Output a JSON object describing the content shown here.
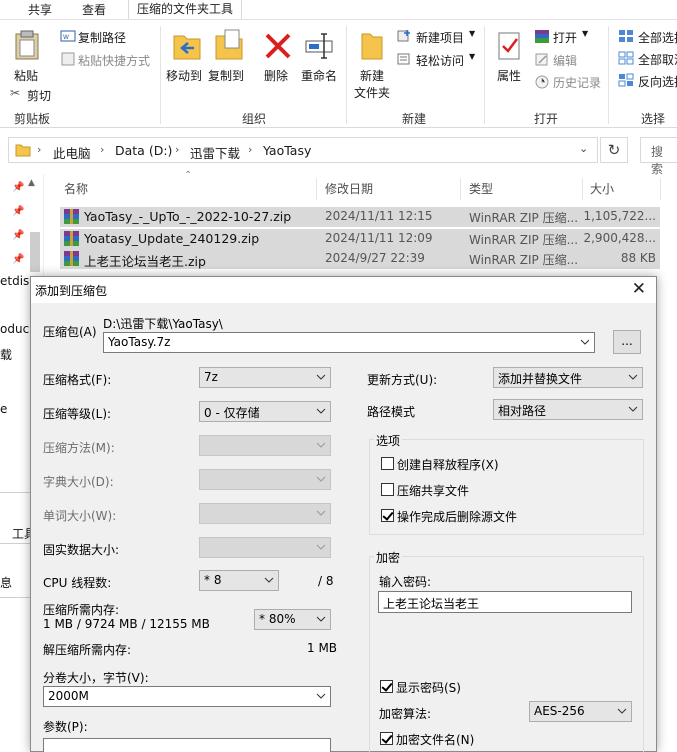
{
  "explorer": {
    "ribbon_tabs": [
      "共享",
      "查看",
      "压缩的文件夹工具"
    ],
    "clipboard": {
      "paste": "粘贴",
      "copy_path": "复制路径",
      "paste_shortcut": "粘贴快捷方式",
      "cut": "剪切",
      "group": "剪贴板"
    },
    "organize": {
      "move_to": "移动到",
      "copy_to": "复制到",
      "delete": "删除",
      "rename": "重命名",
      "group": "组织"
    },
    "new": {
      "new_folder_line1": "新建",
      "new_folder_line2": "文件夹",
      "new_item": "新建项目",
      "easy_access": "轻松访问",
      "group": "新建"
    },
    "open": {
      "properties": "属性",
      "open": "打开",
      "edit": "编辑",
      "history": "历史记录",
      "group": "打开"
    },
    "select": {
      "select_all": "全部选择",
      "select_none": "全部取消",
      "invert": "反向选择",
      "group": "选择"
    },
    "breadcrumb": [
      "此电脑",
      "Data (D:)",
      "迅雷下载",
      "YaoTasy"
    ],
    "search_placeholder": "搜索",
    "columns": {
      "name": "名称",
      "date": "修改日期",
      "type": "类型",
      "size": "大小"
    },
    "files": [
      {
        "name": "YaoTasy_-_UpTo_-_2022-10-27.zip",
        "date": "2024/11/11 12:15",
        "type": "WinRAR ZIP 压缩...",
        "size": "1,105,722..."
      },
      {
        "name": "Yoatasy_Update_240129.zip",
        "date": "2024/11/11 12:09",
        "type": "WinRAR ZIP 压缩...",
        "size": "2,900,428..."
      },
      {
        "name": "上老王论坛当老王.zip",
        "date": "2024/9/27 22:39",
        "type": "WinRAR ZIP 压缩...",
        "size": "88 KB"
      }
    ],
    "nav_fragments": [
      "etdis",
      "oduc",
      "载",
      "e"
    ],
    "bg_fragments": [
      "工具",
      "息"
    ]
  },
  "dialog": {
    "title": "添加到压缩包",
    "archive_label": "压缩包(A)",
    "archive_path": "D:\\迅雷下载\\YaoTasy\\",
    "archive_name": "YaoTasy.7z",
    "browse_label": "...",
    "format_label": "压缩格式(F):",
    "format_value": "7z",
    "level_label": "压缩等级(L):",
    "level_value": "0 - 仅存储",
    "method_label": "压缩方法(M):",
    "dict_label": "字典大小(D):",
    "word_label": "单词大小(W):",
    "solid_label": "固实数据大小:",
    "threads_label": "CPU 线程数:",
    "threads_value": "* 8",
    "threads_max": "/ 8",
    "memory_label": "压缩所需内存:",
    "memory_detail": "1 MB / 9724 MB / 12155 MB",
    "memory_percent": "* 80%",
    "decompress_label": "解压缩所需内存:",
    "decompress_value": "1 MB",
    "volume_label": "分卷大小，字节(V):",
    "volume_value": "2000M",
    "params_label": "参数(P):",
    "update_label": "更新方式(U):",
    "update_value": "添加并替换文件",
    "path_label": "路径模式",
    "path_value": "相对路径",
    "options_legend": "选项",
    "opt_sfx": "创建自释放程序(X)",
    "opt_shared": "压缩共享文件",
    "opt_delete": "操作完成后删除源文件",
    "encrypt_legend": "加密",
    "password_label": "输入密码:",
    "password_value": "上老王论坛当老王",
    "show_password": "显示密码(S)",
    "algo_label": "加密算法:",
    "algo_value": "AES-256",
    "encrypt_names": "加密文件名(N)"
  }
}
